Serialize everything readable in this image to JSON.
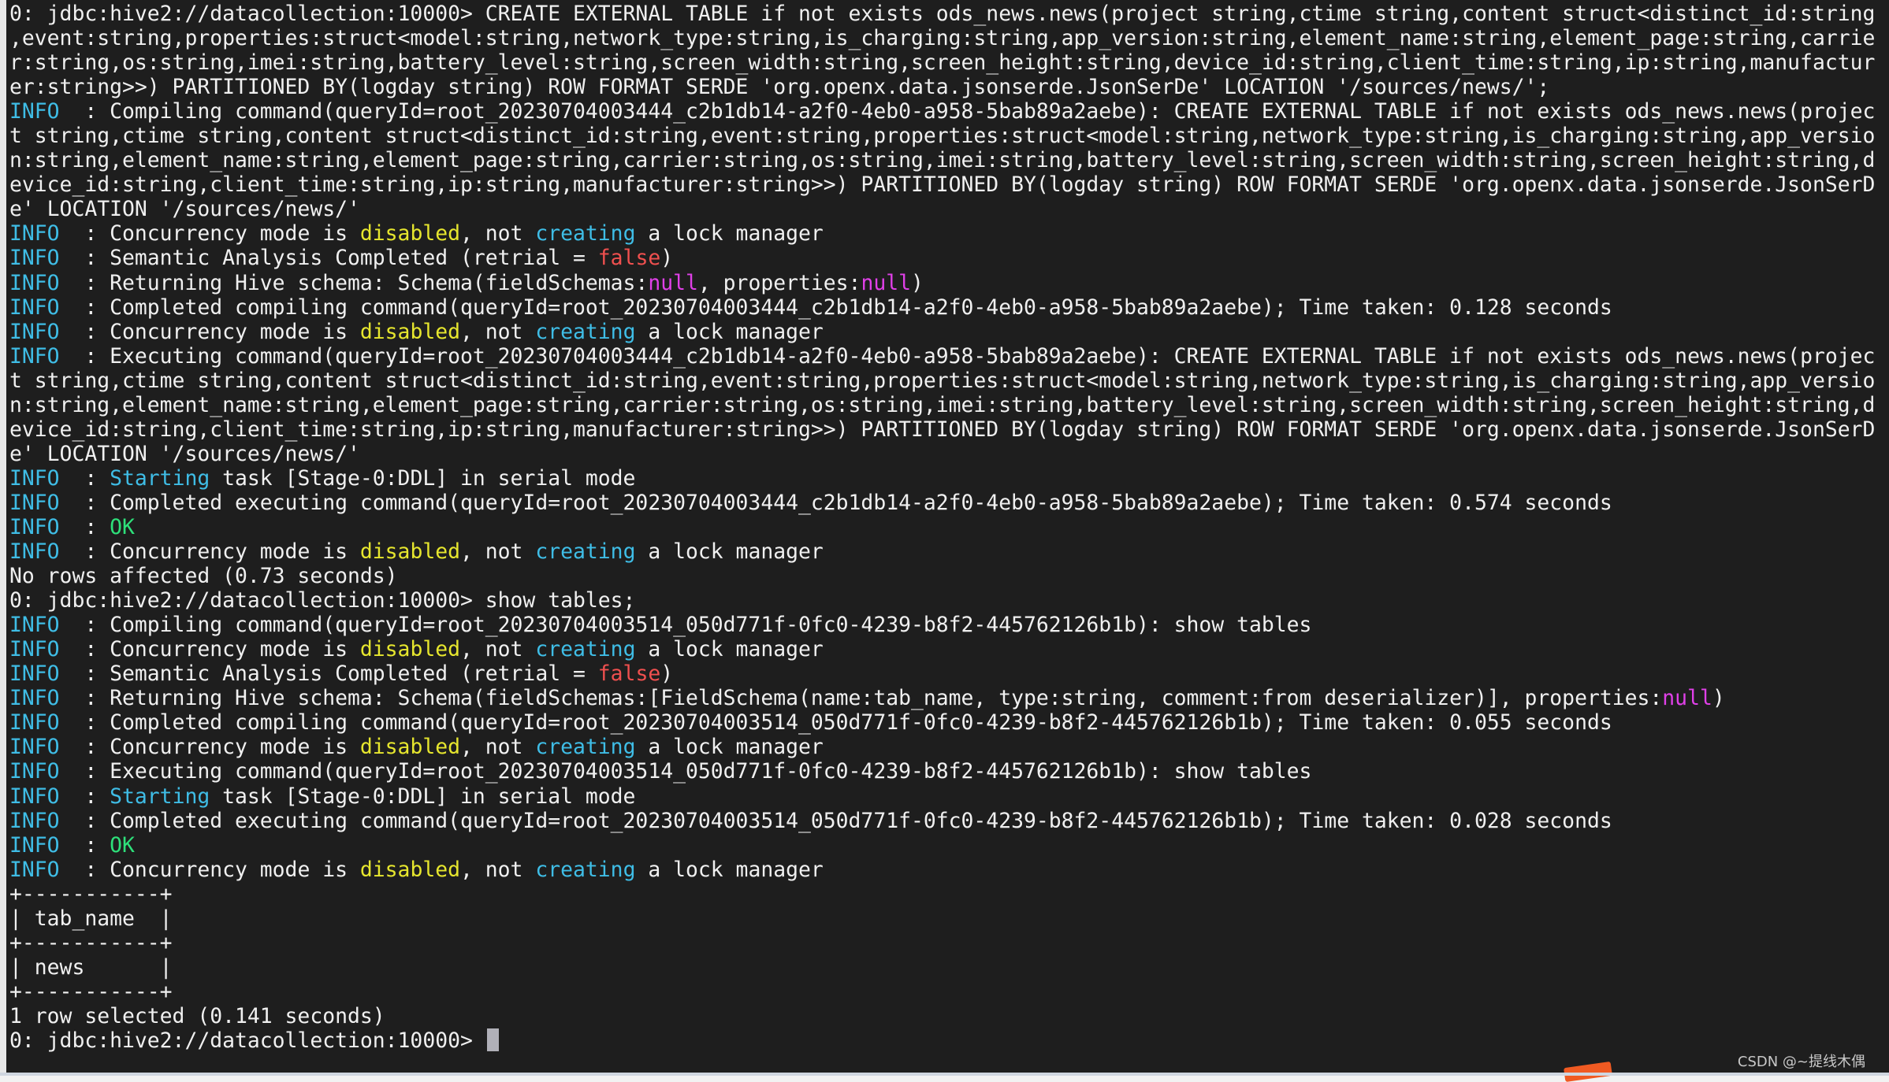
{
  "terminal": {
    "prompt": "0: jdbc:hive2://datacollection:10000>",
    "info_label": "INFO",
    "lines": [
      [
        {
          "t": "0: jdbc:hive2://datacollection:10000> CREATE EXTERNAL TABLE if not exists ods_news.news(project string,ctime string,content struct<distinct_id:string"
        }
      ],
      [
        {
          "t": ",event:string,properties:struct<model:string,network_type:string,is_charging:string,app_version:string,element_name:string,element_page:string,carrie"
        }
      ],
      [
        {
          "t": "r:string,os:string,imei:string,battery_level:string,screen_width:string,screen_height:string,device_id:string,client_time:string,ip:string,manufactur"
        }
      ],
      [
        {
          "t": "er:string>>) PARTITIONED BY(logday string) ROW FORMAT SERDE 'org.openx.data.jsonserde.JsonSerDe' LOCATION '/sources/news/';"
        }
      ],
      [
        {
          "t": "INFO",
          "c": "info"
        },
        {
          "t": "  : Compiling command(queryId=root_20230704003444_c2b1db14-a2f0-4eb0-a958-5bab89a2aebe): CREATE EXTERNAL TABLE if not exists ods_news.news(projec"
        }
      ],
      [
        {
          "t": "t string,ctime string,content struct<distinct_id:string,event:string,properties:struct<model:string,network_type:string,is_charging:string,app_versio"
        }
      ],
      [
        {
          "t": "n:string,element_name:string,element_page:string,carrier:string,os:string,imei:string,battery_level:string,screen_width:string,screen_height:string,d"
        }
      ],
      [
        {
          "t": "evice_id:string,client_time:string,ip:string,manufacturer:string>>) PARTITIONED BY(logday string) ROW FORMAT SERDE 'org.openx.data.jsonserde.JsonSerD"
        }
      ],
      [
        {
          "t": "e' LOCATION '/sources/news/'"
        }
      ],
      [
        {
          "t": "INFO",
          "c": "info"
        },
        {
          "t": "  : Concurrency mode is "
        },
        {
          "t": "disabled",
          "c": "kw-yellow"
        },
        {
          "t": ", not "
        },
        {
          "t": "creating",
          "c": "kw-cyan"
        },
        {
          "t": " a lock manager"
        }
      ],
      [
        {
          "t": "INFO",
          "c": "info"
        },
        {
          "t": "  : Semantic Analysis Completed (retrial = "
        },
        {
          "t": "false",
          "c": "kw-red"
        },
        {
          "t": ")"
        }
      ],
      [
        {
          "t": "INFO",
          "c": "info"
        },
        {
          "t": "  : Returning Hive schema: Schema(fieldSchemas:"
        },
        {
          "t": "null",
          "c": "kw-magenta"
        },
        {
          "t": ", properties:"
        },
        {
          "t": "null",
          "c": "kw-magenta"
        },
        {
          "t": ")"
        }
      ],
      [
        {
          "t": "INFO",
          "c": "info"
        },
        {
          "t": "  : Completed compiling command(queryId=root_20230704003444_c2b1db14-a2f0-4eb0-a958-5bab89a2aebe); Time taken: 0.128 seconds"
        }
      ],
      [
        {
          "t": "INFO",
          "c": "info"
        },
        {
          "t": "  : Concurrency mode is "
        },
        {
          "t": "disabled",
          "c": "kw-yellow"
        },
        {
          "t": ", not "
        },
        {
          "t": "creating",
          "c": "kw-cyan"
        },
        {
          "t": " a lock manager"
        }
      ],
      [
        {
          "t": "INFO",
          "c": "info"
        },
        {
          "t": "  : Executing command(queryId=root_20230704003444_c2b1db14-a2f0-4eb0-a958-5bab89a2aebe): CREATE EXTERNAL TABLE if not exists ods_news.news(projec"
        }
      ],
      [
        {
          "t": "t string,ctime string,content struct<distinct_id:string,event:string,properties:struct<model:string,network_type:string,is_charging:string,app_versio"
        }
      ],
      [
        {
          "t": "n:string,element_name:string,element_page:string,carrier:string,os:string,imei:string,battery_level:string,screen_width:string,screen_height:string,d"
        }
      ],
      [
        {
          "t": "evice_id:string,client_time:string,ip:string,manufacturer:string>>) PARTITIONED BY(logday string) ROW FORMAT SERDE 'org.openx.data.jsonserde.JsonSerD"
        }
      ],
      [
        {
          "t": "e' LOCATION '/sources/news/'"
        }
      ],
      [
        {
          "t": "INFO",
          "c": "info"
        },
        {
          "t": "  : "
        },
        {
          "t": "Starting",
          "c": "kw-cyan"
        },
        {
          "t": " task [Stage-0:DDL] in serial mode"
        }
      ],
      [
        {
          "t": "INFO",
          "c": "info"
        },
        {
          "t": "  : Completed executing command(queryId=root_20230704003444_c2b1db14-a2f0-4eb0-a958-5bab89a2aebe); Time taken: 0.574 seconds"
        }
      ],
      [
        {
          "t": "INFO",
          "c": "info"
        },
        {
          "t": "  : "
        },
        {
          "t": "OK",
          "c": "kw-green"
        }
      ],
      [
        {
          "t": "INFO",
          "c": "info"
        },
        {
          "t": "  : Concurrency mode is "
        },
        {
          "t": "disabled",
          "c": "kw-yellow"
        },
        {
          "t": ", not "
        },
        {
          "t": "creating",
          "c": "kw-cyan"
        },
        {
          "t": " a lock manager"
        }
      ],
      [
        {
          "t": "No rows affected (0.73 seconds)"
        }
      ],
      [
        {
          "t": "0: jdbc:hive2://datacollection:10000> show tables;"
        }
      ],
      [
        {
          "t": "INFO",
          "c": "info"
        },
        {
          "t": "  : Compiling command(queryId=root_20230704003514_050d771f-0fc0-4239-b8f2-445762126b1b): show tables"
        }
      ],
      [
        {
          "t": "INFO",
          "c": "info"
        },
        {
          "t": "  : Concurrency mode is "
        },
        {
          "t": "disabled",
          "c": "kw-yellow"
        },
        {
          "t": ", not "
        },
        {
          "t": "creating",
          "c": "kw-cyan"
        },
        {
          "t": " a lock manager"
        }
      ],
      [
        {
          "t": "INFO",
          "c": "info"
        },
        {
          "t": "  : Semantic Analysis Completed (retrial = "
        },
        {
          "t": "false",
          "c": "kw-red"
        },
        {
          "t": ")"
        }
      ],
      [
        {
          "t": "INFO",
          "c": "info"
        },
        {
          "t": "  : Returning Hive schema: Schema(fieldSchemas:[FieldSchema(name:tab_name, type:string, comment:from deserializer)], properties:"
        },
        {
          "t": "null",
          "c": "kw-magenta"
        },
        {
          "t": ")"
        }
      ],
      [
        {
          "t": "INFO",
          "c": "info"
        },
        {
          "t": "  : Completed compiling command(queryId=root_20230704003514_050d771f-0fc0-4239-b8f2-445762126b1b); Time taken: 0.055 seconds"
        }
      ],
      [
        {
          "t": "INFO",
          "c": "info"
        },
        {
          "t": "  : Concurrency mode is "
        },
        {
          "t": "disabled",
          "c": "kw-yellow"
        },
        {
          "t": ", not "
        },
        {
          "t": "creating",
          "c": "kw-cyan"
        },
        {
          "t": " a lock manager"
        }
      ],
      [
        {
          "t": "INFO",
          "c": "info"
        },
        {
          "t": "  : Executing command(queryId=root_20230704003514_050d771f-0fc0-4239-b8f2-445762126b1b): show tables"
        }
      ],
      [
        {
          "t": "INFO",
          "c": "info"
        },
        {
          "t": "  : "
        },
        {
          "t": "Starting",
          "c": "kw-cyan"
        },
        {
          "t": " task [Stage-0:DDL] in serial mode"
        }
      ],
      [
        {
          "t": "INFO",
          "c": "info"
        },
        {
          "t": "  : Completed executing command(queryId=root_20230704003514_050d771f-0fc0-4239-b8f2-445762126b1b); Time taken: 0.028 seconds"
        }
      ],
      [
        {
          "t": "INFO",
          "c": "info"
        },
        {
          "t": "  : "
        },
        {
          "t": "OK",
          "c": "kw-green"
        }
      ],
      [
        {
          "t": "INFO",
          "c": "info"
        },
        {
          "t": "  : Concurrency mode is "
        },
        {
          "t": "disabled",
          "c": "kw-yellow"
        },
        {
          "t": ", not "
        },
        {
          "t": "creating",
          "c": "kw-cyan"
        },
        {
          "t": " a lock manager"
        }
      ],
      [
        {
          "t": "+-----------+"
        }
      ],
      [
        {
          "t": "| tab_name  |"
        }
      ],
      [
        {
          "t": "+-----------+"
        }
      ],
      [
        {
          "t": "| news      |"
        }
      ],
      [
        {
          "t": "+-----------+"
        }
      ],
      [
        {
          "t": "1 row selected (0.141 seconds)"
        }
      ],
      [
        {
          "t": "0: jdbc:hive2://datacollection:10000> "
        }
      ]
    ],
    "result_table": {
      "columns": [
        "tab_name"
      ],
      "rows": [
        [
          "news"
        ]
      ]
    }
  },
  "colors": {
    "background": "#1e1e1e",
    "foreground": "#f0f0f0",
    "info": "#3fbde6",
    "disabled": "#e6e62e",
    "creating": "#3fbde6",
    "false": "#f0504f",
    "null": "#e040e8",
    "ok": "#2ee07a"
  },
  "watermark": "CSDN @~提线木偶"
}
